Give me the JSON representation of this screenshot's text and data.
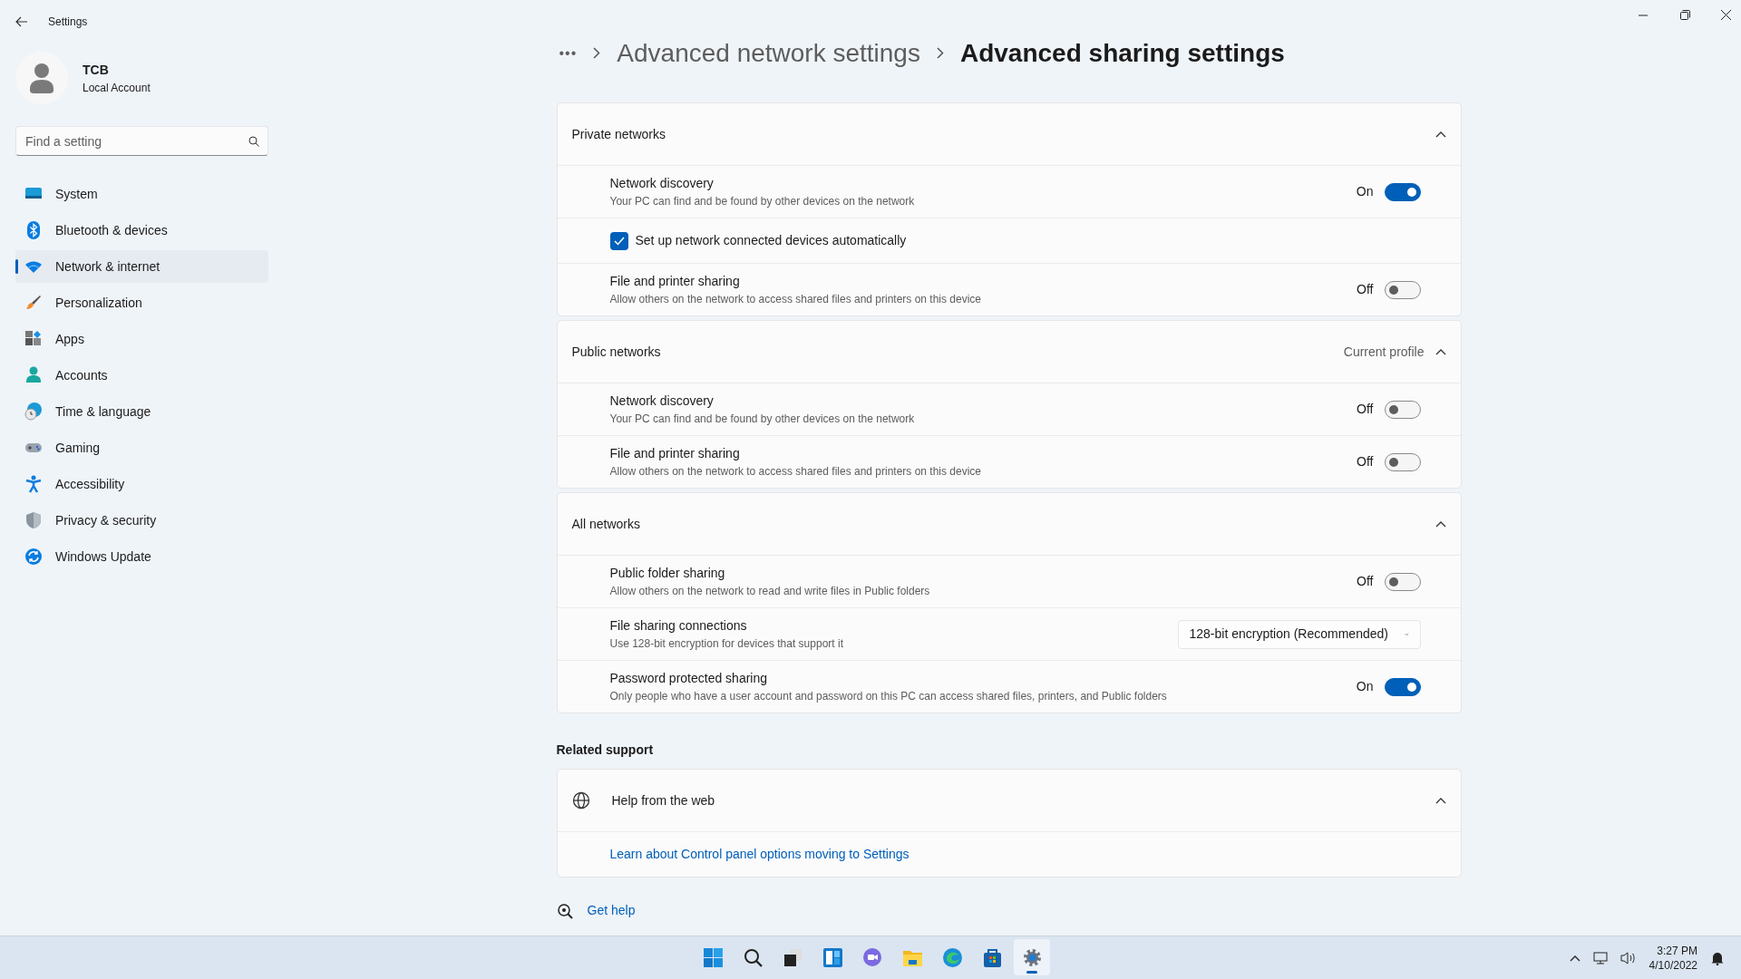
{
  "window": {
    "title": "Settings"
  },
  "account": {
    "name": "TCB",
    "type": "Local Account"
  },
  "search": {
    "placeholder": "Find a setting"
  },
  "sidebar": {
    "items": [
      {
        "label": "System",
        "selected": false
      },
      {
        "label": "Bluetooth & devices",
        "selected": false
      },
      {
        "label": "Network & internet",
        "selected": true
      },
      {
        "label": "Personalization",
        "selected": false
      },
      {
        "label": "Apps",
        "selected": false
      },
      {
        "label": "Accounts",
        "selected": false
      },
      {
        "label": "Time & language",
        "selected": false
      },
      {
        "label": "Gaming",
        "selected": false
      },
      {
        "label": "Accessibility",
        "selected": false
      },
      {
        "label": "Privacy & security",
        "selected": false
      },
      {
        "label": "Windows Update",
        "selected": false
      }
    ]
  },
  "breadcrumb": {
    "overflow": "•••",
    "items": [
      "Advanced network settings",
      "Advanced sharing settings"
    ]
  },
  "sections": [
    {
      "title": "Private networks",
      "expanded": true,
      "rows": [
        {
          "kind": "toggle",
          "title": "Network discovery",
          "description": "Your PC can find and be found by other devices on the network",
          "state_label": "On",
          "on": true
        },
        {
          "kind": "checkbox",
          "label": "Set up network connected devices automatically",
          "checked": true
        },
        {
          "kind": "toggle",
          "title": "File and printer sharing",
          "description": "Allow others on the network to access shared files and printers on this device",
          "state_label": "Off",
          "on": false
        }
      ]
    },
    {
      "title": "Public networks",
      "note": "Current profile",
      "expanded": true,
      "rows": [
        {
          "kind": "toggle",
          "title": "Network discovery",
          "description": "Your PC can find and be found by other devices on the network",
          "state_label": "Off",
          "on": false
        },
        {
          "kind": "toggle",
          "title": "File and printer sharing",
          "description": "Allow others on the network to access shared files and printers on this device",
          "state_label": "Off",
          "on": false
        }
      ]
    },
    {
      "title": "All networks",
      "expanded": true,
      "rows": [
        {
          "kind": "toggle",
          "title": "Public folder sharing",
          "description": "Allow others on the network to read and write files in Public folders",
          "state_label": "Off",
          "on": false
        },
        {
          "kind": "dropdown",
          "title": "File sharing connections",
          "description": "Use 128-bit encryption for devices that support it",
          "value": "128-bit encryption (Recommended)"
        },
        {
          "kind": "toggle",
          "title": "Password protected sharing",
          "description": "Only people who have a user account and password on this PC can access shared files, printers, and Public folders",
          "state_label": "On",
          "on": true
        }
      ]
    }
  ],
  "related_support": {
    "heading": "Related support",
    "card": {
      "title": "Help from the web",
      "expanded": true,
      "links": [
        "Learn about Control panel options moving to Settings"
      ]
    }
  },
  "get_help": "Get help",
  "taskbar": {
    "apps": [
      {
        "selected": false
      },
      {
        "selected": false
      },
      {
        "selected": false
      },
      {
        "selected": false
      },
      {
        "selected": false
      },
      {
        "selected": false
      },
      {
        "selected": false
      },
      {
        "selected": false
      },
      {
        "selected": true
      }
    ],
    "time": "3:27 PM",
    "date": "4/10/2022"
  }
}
